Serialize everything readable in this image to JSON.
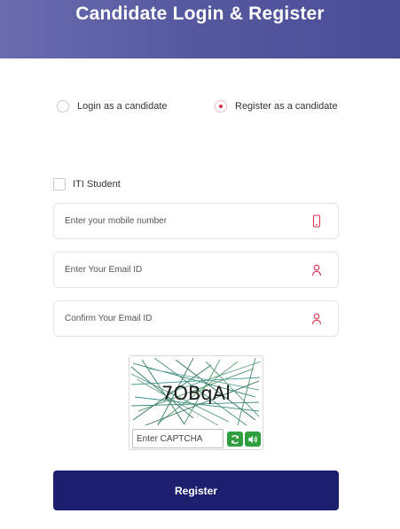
{
  "header": {
    "title": "Candidate Login & Register"
  },
  "mode_options": [
    {
      "label": "Login as a candidate",
      "selected": false
    },
    {
      "label": "Register as a candidate",
      "selected": true
    }
  ],
  "iti_student": {
    "label": "ITI Student",
    "checked": false
  },
  "fields": {
    "mobile": {
      "placeholder": "Enter your mobile number",
      "value": "",
      "icon": "mobile-phone-icon"
    },
    "email": {
      "placeholder": "Enter Your Email ID",
      "value": "",
      "icon": "user-icon"
    },
    "confirm_email": {
      "placeholder": "Confirm Your Email ID",
      "value": "",
      "icon": "user-icon"
    }
  },
  "captcha": {
    "text": "7OBqAl",
    "input_placeholder": "Enter CAPTCHA",
    "refresh_icon": "refresh-icon",
    "audio_icon": "speaker-icon"
  },
  "register_button": {
    "label": "Register"
  },
  "colors": {
    "header_start": "#6a6cae",
    "header_end": "#4a4d96",
    "accent_red": "#e0314f",
    "button_navy": "#1b1f6d",
    "captcha_green": "#2e9e3e"
  }
}
